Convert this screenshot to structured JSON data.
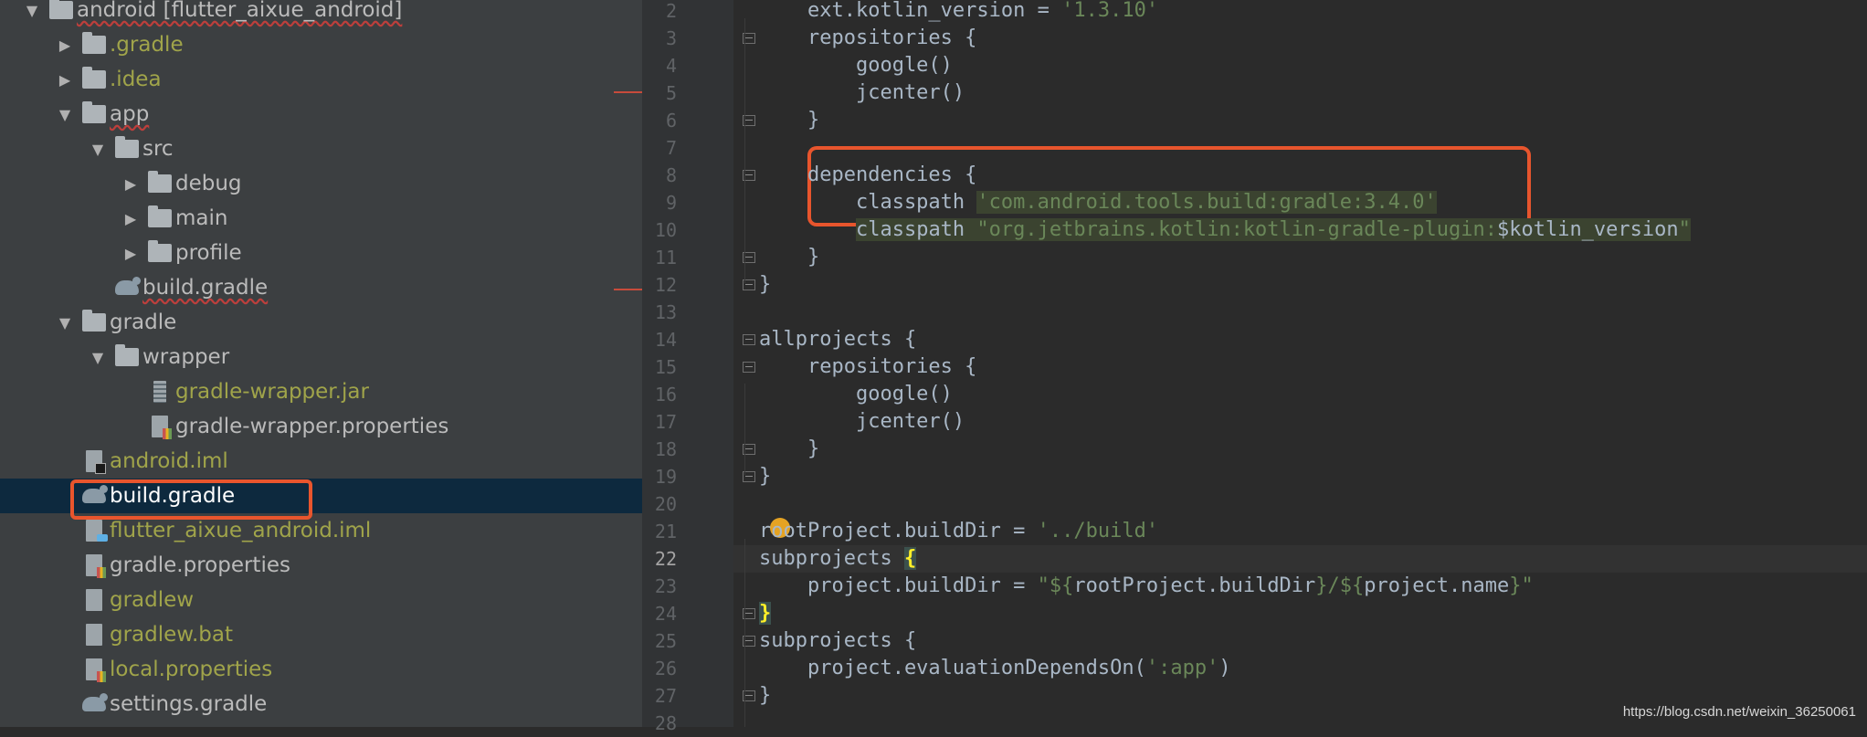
{
  "project_tree": {
    "items": [
      {
        "label": "android [flutter_aixue_android]",
        "arrow": "down",
        "icon": "folder",
        "depth": 0,
        "style": "root"
      },
      {
        "label": ".gradle",
        "arrow": "right",
        "icon": "folder",
        "depth": 1,
        "style": "yellow"
      },
      {
        "label": ".idea",
        "arrow": "right",
        "icon": "folder",
        "depth": 1,
        "style": "yellow"
      },
      {
        "label": "app",
        "arrow": "down",
        "icon": "folder",
        "depth": 1,
        "style": "squiggle"
      },
      {
        "label": "src",
        "arrow": "down",
        "icon": "folder",
        "depth": 2,
        "style": "normal"
      },
      {
        "label": "debug",
        "arrow": "right",
        "icon": "folder",
        "depth": 3,
        "style": "normal"
      },
      {
        "label": "main",
        "arrow": "right",
        "icon": "folder",
        "depth": 3,
        "style": "normal"
      },
      {
        "label": "profile",
        "arrow": "right",
        "icon": "folder",
        "depth": 3,
        "style": "normal"
      },
      {
        "label": "build.gradle",
        "arrow": "none",
        "icon": "gradle",
        "depth": 2,
        "style": "squiggle"
      },
      {
        "label": "gradle",
        "arrow": "down",
        "icon": "folder",
        "depth": 1,
        "style": "normal"
      },
      {
        "label": "wrapper",
        "arrow": "down",
        "icon": "folder",
        "depth": 2,
        "style": "normal"
      },
      {
        "label": "gradle-wrapper.jar",
        "arrow": "none",
        "icon": "jar",
        "depth": 3,
        "style": "yellow"
      },
      {
        "label": "gradle-wrapper.properties",
        "arrow": "none",
        "icon": "props",
        "depth": 3,
        "style": "normal"
      },
      {
        "label": "android.iml",
        "arrow": "none",
        "icon": "iml",
        "depth": 1,
        "style": "yellow"
      },
      {
        "label": "build.gradle",
        "arrow": "none",
        "icon": "gradle",
        "depth": 1,
        "style": "selected"
      },
      {
        "label": "flutter_aixue_android.iml",
        "arrow": "none",
        "icon": "flutter",
        "depth": 1,
        "style": "yellow"
      },
      {
        "label": "gradle.properties",
        "arrow": "none",
        "icon": "props",
        "depth": 1,
        "style": "normal"
      },
      {
        "label": "gradlew",
        "arrow": "none",
        "icon": "file",
        "depth": 1,
        "style": "yellow"
      },
      {
        "label": "gradlew.bat",
        "arrow": "none",
        "icon": "file",
        "depth": 1,
        "style": "yellow"
      },
      {
        "label": "local.properties",
        "arrow": "none",
        "icon": "props",
        "depth": 1,
        "style": "yellow"
      },
      {
        "label": "settings.gradle",
        "arrow": "none",
        "icon": "gradle",
        "depth": 1,
        "style": "normal"
      }
    ]
  },
  "editor": {
    "current_line": "22",
    "lines": [
      {
        "n": "2",
        "segs": [
          [
            "    ext.kotlin_version = ",
            ""
          ],
          [
            "'1.3.10'",
            "str"
          ]
        ]
      },
      {
        "n": "3",
        "segs": [
          [
            "    repositories {",
            ""
          ]
        ]
      },
      {
        "n": "4",
        "segs": [
          [
            "        google()",
            ""
          ]
        ]
      },
      {
        "n": "5",
        "segs": [
          [
            "        jcenter()",
            ""
          ]
        ]
      },
      {
        "n": "6",
        "segs": [
          [
            "    }",
            ""
          ]
        ]
      },
      {
        "n": "7",
        "segs": []
      },
      {
        "n": "8",
        "segs": [
          [
            "    dependencies {",
            ""
          ]
        ]
      },
      {
        "n": "9",
        "segs": [
          [
            "        classpath ",
            ""
          ],
          [
            "'com.android.tools.build:gradle:3.4.0'",
            "str hl"
          ]
        ]
      },
      {
        "n": "10",
        "segs": [
          [
            "        ",
            ""
          ],
          [
            "classpath ",
            "hl"
          ],
          [
            "\"org.jetbrains.kotlin:kotlin-gradle-plugin:",
            "str hl"
          ],
          [
            "$kotlin_version",
            "hl"
          ],
          [
            "\"",
            "str hl"
          ]
        ]
      },
      {
        "n": "11",
        "segs": [
          [
            "    }",
            ""
          ]
        ]
      },
      {
        "n": "12",
        "segs": [
          [
            "}",
            ""
          ]
        ]
      },
      {
        "n": "13",
        "segs": []
      },
      {
        "n": "14",
        "segs": [
          [
            "allprojects {",
            ""
          ]
        ]
      },
      {
        "n": "15",
        "segs": [
          [
            "    repositories {",
            ""
          ]
        ]
      },
      {
        "n": "16",
        "segs": [
          [
            "        google()",
            ""
          ]
        ]
      },
      {
        "n": "17",
        "segs": [
          [
            "        jcenter()",
            ""
          ]
        ]
      },
      {
        "n": "18",
        "segs": [
          [
            "    }",
            ""
          ]
        ]
      },
      {
        "n": "19",
        "segs": [
          [
            "}",
            ""
          ]
        ]
      },
      {
        "n": "20",
        "segs": []
      },
      {
        "n": "21",
        "segs": [
          [
            "rootProject.buildDir = ",
            ""
          ],
          [
            "'../build'",
            "str"
          ]
        ]
      },
      {
        "n": "22",
        "segs": [
          [
            "subprojects ",
            ""
          ],
          [
            "{",
            "brace-match"
          ]
        ]
      },
      {
        "n": "23",
        "segs": [
          [
            "    project.buildDir = ",
            ""
          ],
          [
            "\"${",
            "str"
          ],
          [
            "rootProject.buildDir",
            ""
          ],
          [
            "}/${",
            "str"
          ],
          [
            "project.name",
            ""
          ],
          [
            "}\"",
            "str"
          ]
        ]
      },
      {
        "n": "24",
        "segs": [
          [
            "}",
            "brace-match"
          ]
        ]
      },
      {
        "n": "25",
        "segs": [
          [
            "subprojects {",
            ""
          ]
        ]
      },
      {
        "n": "26",
        "segs": [
          [
            "    project.evaluationDependsOn(",
            ""
          ],
          [
            "':app'",
            "str"
          ],
          [
            ")",
            ""
          ]
        ]
      },
      {
        "n": "27",
        "segs": [
          [
            "}",
            ""
          ]
        ]
      },
      {
        "n": "28",
        "segs": []
      }
    ]
  },
  "watermark": "https://blog.csdn.net/weixin_36250061",
  "colors": {
    "highlight_box": "#e8552d",
    "selection": "#0d293e",
    "string": "#6a8759"
  }
}
